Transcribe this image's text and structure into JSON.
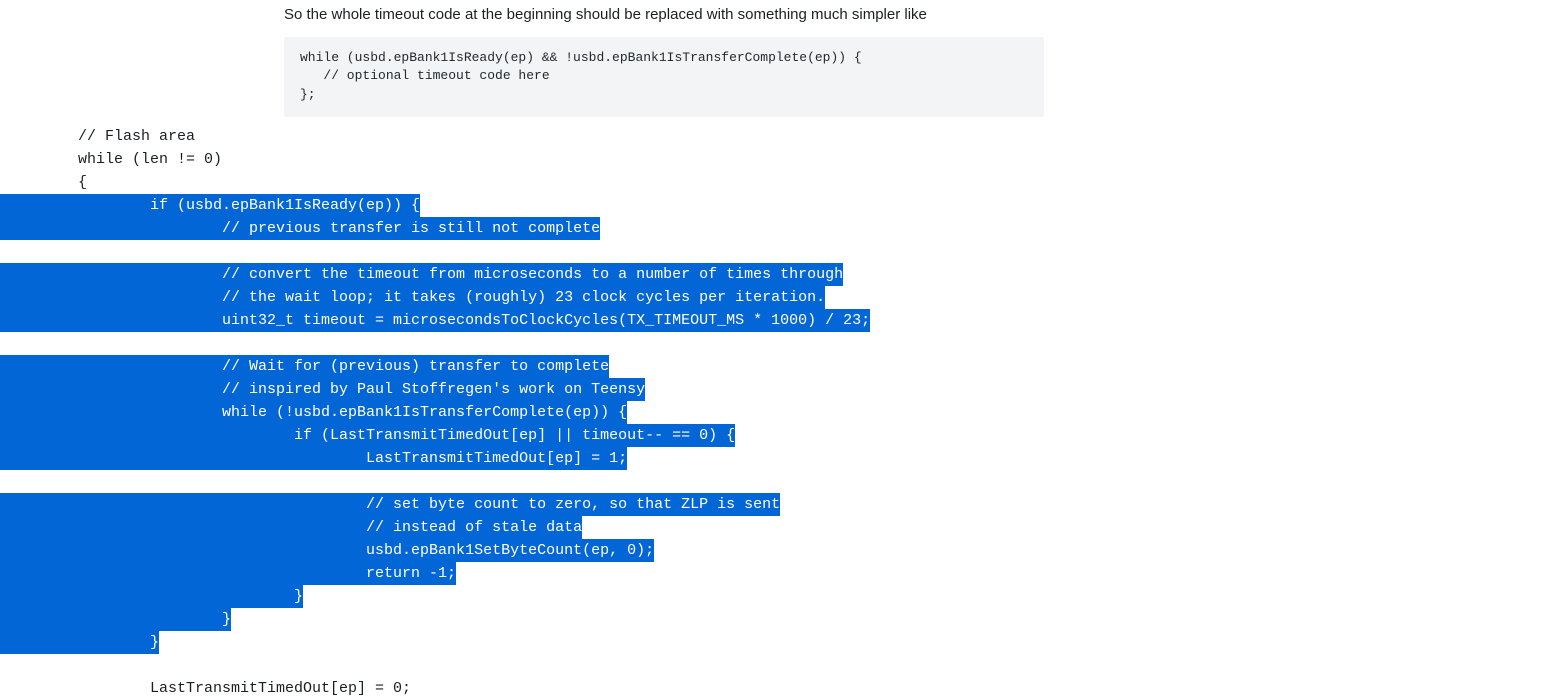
{
  "comment": {
    "intro_text": "So the whole timeout code at the beginning should be replaced with something much simpler like",
    "code_snippet": "while (usbd.epBank1IsReady(ep) && !usbd.epBank1IsTransferComplete(ep)) {\n   // optional timeout code here\n};"
  },
  "diff_code": {
    "lines": [
      {
        "indent": "",
        "pre": "// Flash area",
        "sel": "",
        "post": ""
      },
      {
        "indent": "",
        "pre": "while (len != 0)",
        "sel": "",
        "post": ""
      },
      {
        "indent": "",
        "pre": "{",
        "sel": "",
        "post": ""
      },
      {
        "indent": "        ",
        "pre": "",
        "sel": "if (usbd.epBank1IsReady(ep)) {",
        "post": ""
      },
      {
        "indent": "                ",
        "pre": "",
        "sel": "// previous transfer is still not complete",
        "post": ""
      },
      {
        "indent": "",
        "pre": "",
        "sel": "",
        "post": ""
      },
      {
        "indent": "                ",
        "pre": "",
        "sel": "// convert the timeout from microseconds to a number of times through",
        "post": ""
      },
      {
        "indent": "                ",
        "pre": "",
        "sel": "// the wait loop; it takes (roughly) 23 clock cycles per iteration.",
        "post": ""
      },
      {
        "indent": "                ",
        "pre": "",
        "sel": "uint32_t timeout = microsecondsToClockCycles(TX_TIMEOUT_MS * 1000) / 23;",
        "post": ""
      },
      {
        "indent": "",
        "pre": "",
        "sel": "",
        "post": ""
      },
      {
        "indent": "                ",
        "pre": "",
        "sel": "// Wait for (previous) transfer to complete",
        "post": ""
      },
      {
        "indent": "                ",
        "pre": "",
        "sel": "// inspired by Paul Stoffregen's work on Teensy",
        "post": ""
      },
      {
        "indent": "                ",
        "pre": "",
        "sel": "while (!usbd.epBank1IsTransferComplete(ep)) {",
        "post": ""
      },
      {
        "indent": "                        ",
        "pre": "",
        "sel": "if (LastTransmitTimedOut[ep] || timeout-- == 0) {",
        "post": ""
      },
      {
        "indent": "                                ",
        "pre": "",
        "sel": "LastTransmitTimedOut[ep] = 1;",
        "post": ""
      },
      {
        "indent": "",
        "pre": "",
        "sel": "",
        "post": ""
      },
      {
        "indent": "                                ",
        "pre": "",
        "sel": "// set byte count to zero, so that ZLP is sent",
        "post": ""
      },
      {
        "indent": "                                ",
        "pre": "",
        "sel": "// instead of stale data",
        "post": ""
      },
      {
        "indent": "                                ",
        "pre": "",
        "sel": "usbd.epBank1SetByteCount(ep, 0);",
        "post": ""
      },
      {
        "indent": "                                ",
        "pre": "",
        "sel": "return -1;",
        "post": ""
      },
      {
        "indent": "                        ",
        "pre": "",
        "sel": "}",
        "post": ""
      },
      {
        "indent": "                ",
        "pre": "",
        "sel": "}",
        "post": ""
      },
      {
        "indent": "        ",
        "pre": "",
        "sel": "}",
        "post": ""
      },
      {
        "indent": "",
        "pre": "",
        "sel": "",
        "post": ""
      },
      {
        "indent": "        ",
        "pre": "LastTransmitTimedOut[ep] = 0;",
        "sel": "",
        "post": ""
      }
    ]
  },
  "colors": {
    "highlight_bg": "#0366d6",
    "highlight_fg": "#ffffff",
    "code_block_bg": "#f2f4f6"
  }
}
